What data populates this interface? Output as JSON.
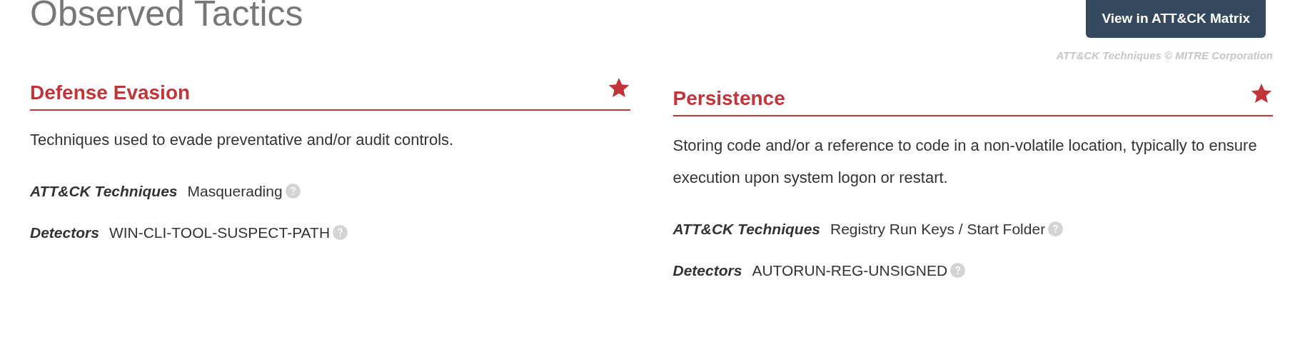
{
  "page_title": "Observed Tactics",
  "matrix_button": "View in ATT&CK Matrix",
  "copyright": "ATT&CK Techniques © MITRE Corporation",
  "tactics": [
    {
      "name": "Defense Evasion",
      "starred": true,
      "description": "Techniques used to evade preventative and/or audit controls.",
      "details": [
        {
          "label": "ATT&CK Techniques",
          "value": "Masquerading"
        },
        {
          "label": "Detectors",
          "value": "WIN-CLI-TOOL-SUSPECT-PATH"
        }
      ]
    },
    {
      "name": "Persistence",
      "starred": true,
      "description": "Storing code and/or a reference to code in a non-volatile location, typically to ensure execution upon system logon or restart.",
      "details": [
        {
          "label": "ATT&CK Techniques",
          "value": "Registry Run Keys / Start Folder"
        },
        {
          "label": "Detectors",
          "value": "AUTORUN-REG-UNSIGNED"
        }
      ]
    }
  ]
}
